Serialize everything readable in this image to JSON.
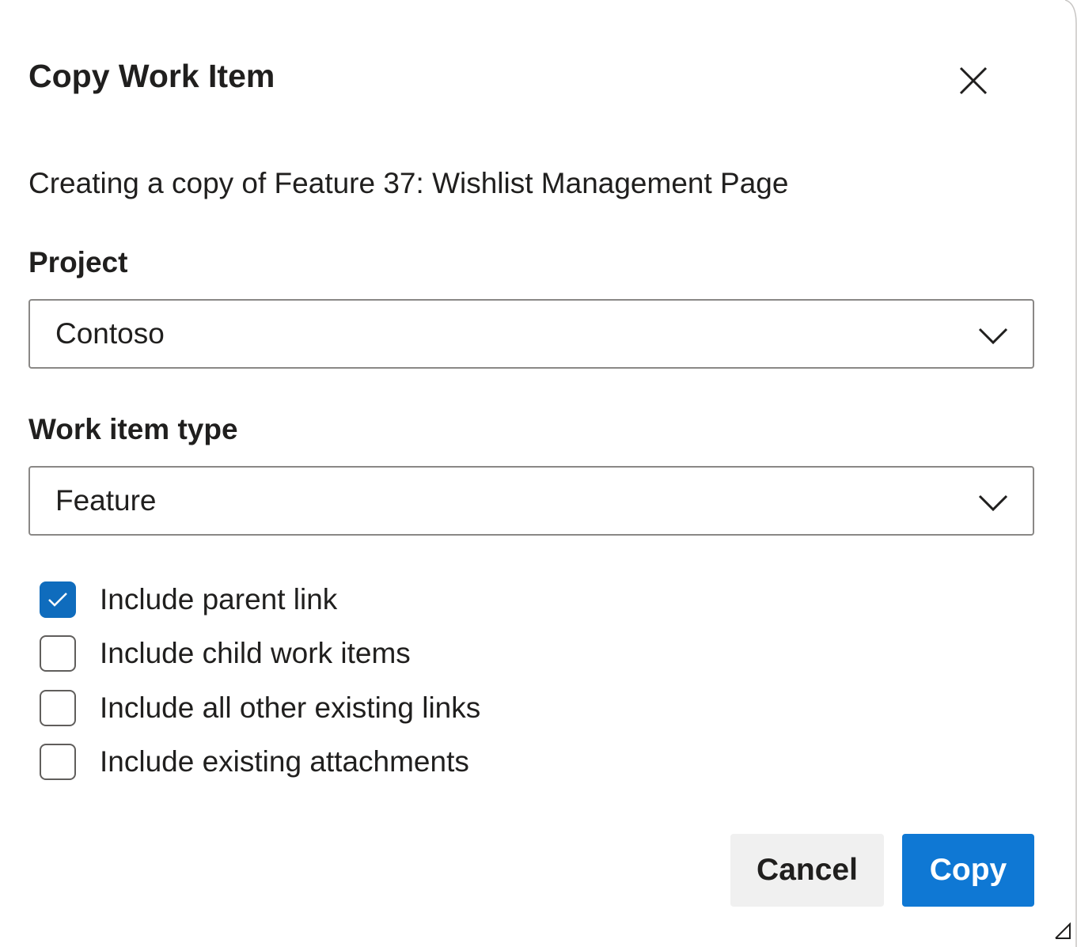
{
  "dialog": {
    "title": "Copy Work Item",
    "close_icon": "close-icon",
    "subtitle": "Creating a copy of Feature 37: Wishlist Management Page"
  },
  "project": {
    "label": "Project",
    "value": "Contoso",
    "icon": "chevron-down-icon"
  },
  "work_item_type": {
    "label": "Work item type",
    "value": "Feature",
    "icon": "chevron-down-icon"
  },
  "options": [
    {
      "label": "Include parent link",
      "checked": true
    },
    {
      "label": "Include child work items",
      "checked": false
    },
    {
      "label": "Include all other existing links",
      "checked": false
    },
    {
      "label": "Include existing attachments",
      "checked": false
    }
  ],
  "buttons": {
    "cancel_label": "Cancel",
    "copy_label": "Copy"
  },
  "colors": {
    "primary": "#0f78d4",
    "checked": "#0f6cbd",
    "secondary_button": "#f0f0f0",
    "border": "#8a8886"
  }
}
